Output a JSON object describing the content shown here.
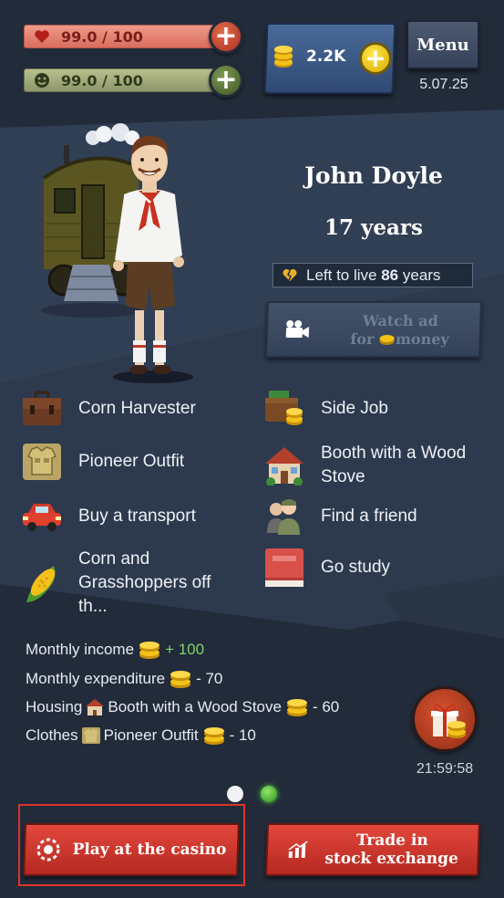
{
  "stats": {
    "health": "99.0 / 100",
    "happiness": "99.0 / 100"
  },
  "header": {
    "coins": "2.2K",
    "menu_label": "Menu",
    "date": "5.07.25"
  },
  "character": {
    "name": "John Doyle",
    "age": "17 years",
    "left_to_live_prefix": "Left to live ",
    "left_to_live_value": "86",
    "left_to_live_suffix": " years"
  },
  "watch_ad": {
    "line1": "Watch ad",
    "line2_a": "for",
    "line2_b": "money"
  },
  "items": [
    {
      "label": "Corn Harvester",
      "icon": "briefcase-icon"
    },
    {
      "label": "Side Job",
      "icon": "wallet-icon"
    },
    {
      "label": "Pioneer Outfit",
      "icon": "shirt-icon"
    },
    {
      "label": "Booth with a Wood Stove",
      "icon": "house-icon"
    },
    {
      "label": "Buy a transport",
      "icon": "car-icon"
    },
    {
      "label": "Find a friend",
      "icon": "friends-icon"
    },
    {
      "label": "Corn and Grasshoppers off th...",
      "icon": "corn-icon"
    },
    {
      "label": "Go study",
      "icon": "book-icon"
    }
  ],
  "finances": {
    "income_label": "Monthly income",
    "income_value": "+ 100",
    "expenditure_label": "Monthly expenditure",
    "expenditure_value": "- 70",
    "housing_label": "Housing",
    "housing_name": "Booth with a Wood Stove",
    "housing_value": "- 60",
    "clothes_label": "Clothes",
    "clothes_name": "Pioneer Outfit",
    "clothes_value": "- 10"
  },
  "gift": {
    "timer": "21:59:58"
  },
  "buttons": {
    "casino": "Play at the casino",
    "stock_line1": "Trade in",
    "stock_line2": "stock exchange"
  },
  "colors": {
    "background": "#222b3a",
    "health_bar": "#e08575",
    "happiness_bar": "#a4ab7a",
    "accent_red": "#d93a30",
    "coin_gold": "#f2c21a"
  }
}
